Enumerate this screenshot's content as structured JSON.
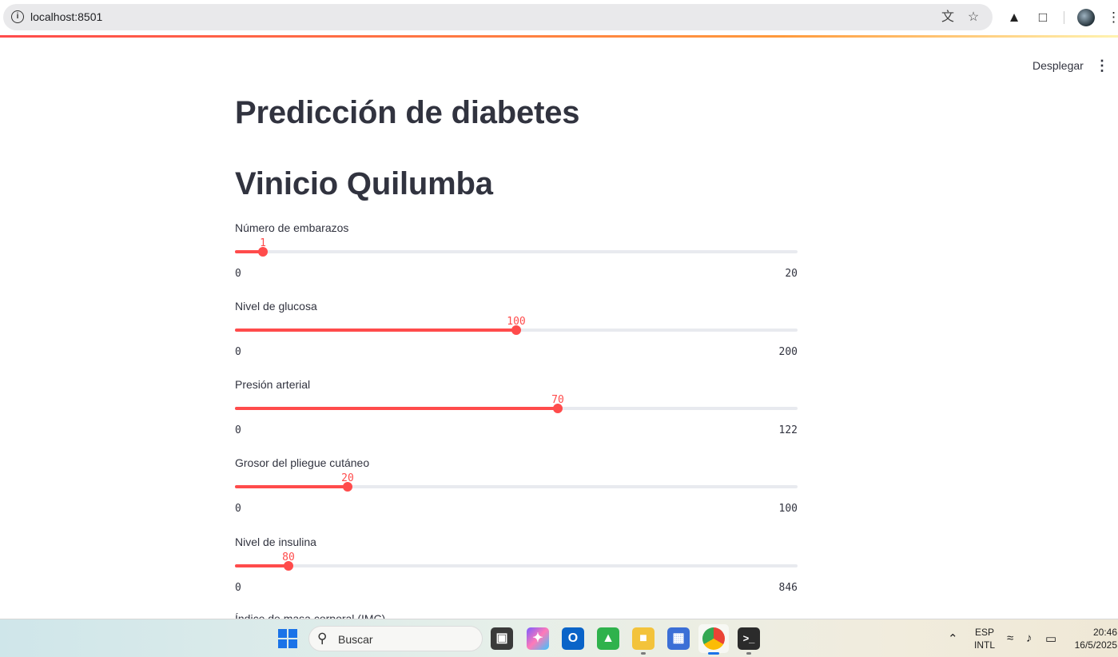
{
  "browser": {
    "url": "localhost:8501",
    "info_icon": "info-icon",
    "translate_icon": "translate-icon",
    "bookmark_icon": "star-icon",
    "extension_icons": [
      "adobe-icon",
      "puzzle-extensions-icon"
    ],
    "profile_icon": "avatar",
    "menu_icon": "kebab-menu-icon"
  },
  "app_header": {
    "deploy_label": "Desplegar",
    "menu_icon": "kebab-menu-icon"
  },
  "main": {
    "title": "Predicción de diabetes",
    "subtitle": "Vinicio Quilumba",
    "sliders": [
      {
        "label": "Número de embarazos",
        "value": "1",
        "min": "0",
        "max": "20",
        "fraction": 0.05
      },
      {
        "label": "Nivel de glucosa",
        "value": "100",
        "min": "0",
        "max": "200",
        "fraction": 0.5
      },
      {
        "label": "Presión arterial",
        "value": "70",
        "min": "0",
        "max": "122",
        "fraction": 0.574
      },
      {
        "label": "Grosor del pliegue cutáneo",
        "value": "20",
        "min": "0",
        "max": "100",
        "fraction": 0.2
      },
      {
        "label": "Nivel de insulina",
        "value": "80",
        "min": "0",
        "max": "846",
        "fraction": 0.0946
      }
    ],
    "next_label_partial": "Índice de masa corporal (IMC)"
  },
  "taskbar": {
    "search_placeholder": "Buscar",
    "apps": [
      "windows-start-icon",
      "task-view-icon",
      "copilot-icon",
      "outlook-icon",
      "app-icon",
      "file-explorer-icon",
      "remote-app-icon",
      "chrome-icon",
      "terminal-icon"
    ],
    "tray": {
      "language_line1": "ESP",
      "language_line2": "INTL",
      "time": "20:46",
      "date": "16/5/2025"
    }
  },
  "colors": {
    "accent": "#ff4b4b",
    "track": "#e8eaef",
    "text": "#31333f"
  }
}
